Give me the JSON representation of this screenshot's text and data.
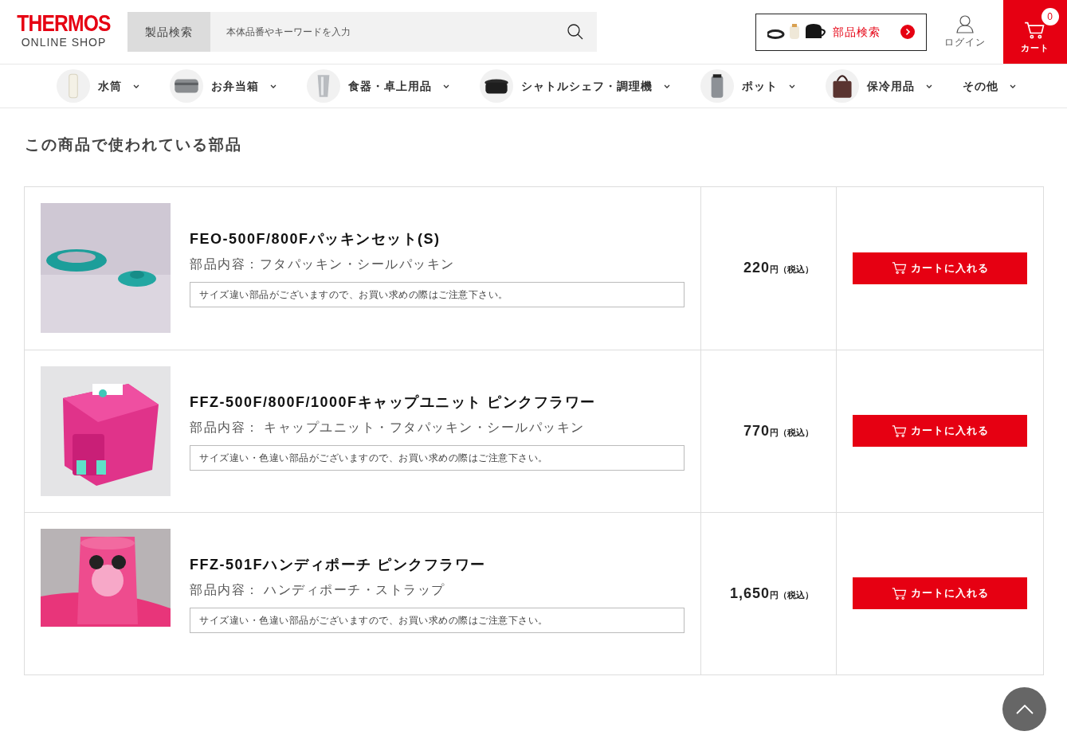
{
  "header": {
    "logo": {
      "brand": "THERMOS",
      "sub": "ONLINE SHOP"
    },
    "search": {
      "category": "製品検索",
      "placeholder": "本体品番やキーワードを入力"
    },
    "parts_search": {
      "label": "部品検索"
    },
    "login": {
      "label": "ログイン"
    },
    "cart": {
      "label": "カート",
      "count": "0"
    }
  },
  "nav": [
    {
      "label": "水筒",
      "kind": "bottle"
    },
    {
      "label": "お弁当箱",
      "kind": "lunchbox"
    },
    {
      "label": "食器・卓上用品",
      "kind": "tumbler"
    },
    {
      "label": "シャトルシェフ・調理機",
      "kind": "pot"
    },
    {
      "label": "ポット",
      "kind": "jug"
    },
    {
      "label": "保冷用品",
      "kind": "bag"
    },
    {
      "label": "その他",
      "kind": "none"
    }
  ],
  "section_title": "この商品で使われている部品",
  "products": [
    {
      "name": "FEO-500F/800Fパッキンセット(S)",
      "contents": "部品内容：フタパッキン・シールパッキン",
      "notice": "サイズ違い部品がございますので、お買い求めの際はご注意下さい。",
      "price": "220",
      "yen": "円",
      "tax": "（税込）",
      "button": "カートに入れる"
    },
    {
      "name": "FFZ-500F/800F/1000Fキャップユニット ピンクフラワー",
      "contents": "部品内容： キャップユニット・フタパッキン・シールパッキン",
      "notice": "サイズ違い・色違い部品がございますので、お買い求めの際はご注意下さい。",
      "price": "770",
      "yen": "円",
      "tax": "（税込）",
      "button": "カートに入れる"
    },
    {
      "name": "FFZ-501Fハンディポーチ ピンクフラワー",
      "contents": "部品内容： ハンディポーチ・ストラップ",
      "notice": "サイズ違い・色違い部品がございますので、お買い求めの際はご注意下さい。",
      "price": "1,650",
      "yen": "円",
      "tax": "（税込）",
      "button": "カートに入れる"
    }
  ]
}
